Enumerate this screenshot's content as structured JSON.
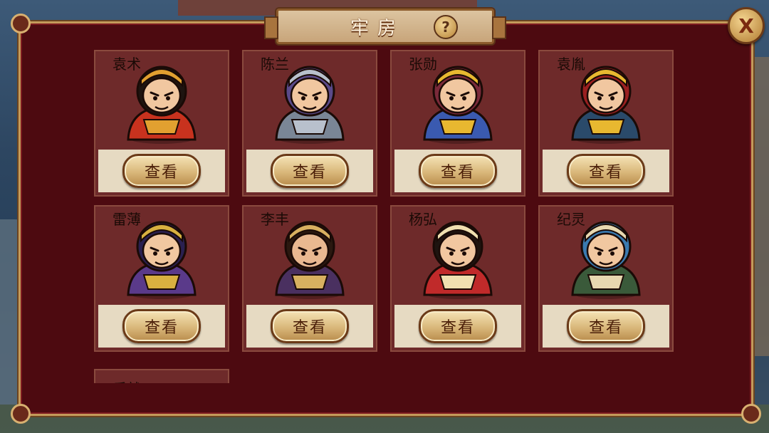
{
  "window": {
    "title": "牢房",
    "help_glyph": "?",
    "close_glyph": "X"
  },
  "prisoners": [
    {
      "name": "袁术",
      "action": "查看",
      "palette": {
        "skin": "#f1c7a0",
        "hair": "#1e1410",
        "armor": "#c8321e",
        "trim": "#e2a030"
      }
    },
    {
      "name": "陈兰",
      "action": "查看",
      "palette": {
        "skin": "#f1c7a0",
        "hair": "#5a4a8a",
        "armor": "#7a8696",
        "trim": "#b8c0cc"
      }
    },
    {
      "name": "张勋",
      "action": "查看",
      "palette": {
        "skin": "#f1c7a0",
        "hair": "#7a2a3a",
        "armor": "#3a5ab0",
        "trim": "#e8b830"
      }
    },
    {
      "name": "袁胤",
      "action": "查看",
      "palette": {
        "skin": "#f1c7a0",
        "hair": "#9a2020",
        "armor": "#2a4a6a",
        "trim": "#e8b830"
      }
    },
    {
      "name": "雷薄",
      "action": "查看",
      "palette": {
        "skin": "#f1c7a0",
        "hair": "#2a2050",
        "armor": "#5a3a8a",
        "trim": "#d8b040"
      }
    },
    {
      "name": "李丰",
      "action": "查看",
      "palette": {
        "skin": "#e9b890",
        "hair": "#2a1810",
        "armor": "#4a3060",
        "trim": "#d8b060"
      }
    },
    {
      "name": "杨弘",
      "action": "查看",
      "palette": {
        "skin": "#f1c7a0",
        "hair": "#1e1410",
        "armor": "#c02a2a",
        "trim": "#f0e0b0"
      }
    },
    {
      "name": "纪灵",
      "action": "查看",
      "palette": {
        "skin": "#f1c7a0",
        "hair": "#3a7ab0",
        "armor": "#3a5a3a",
        "trim": "#e8d8b0"
      }
    }
  ],
  "partial_prisoner": {
    "name": "乐就"
  }
}
